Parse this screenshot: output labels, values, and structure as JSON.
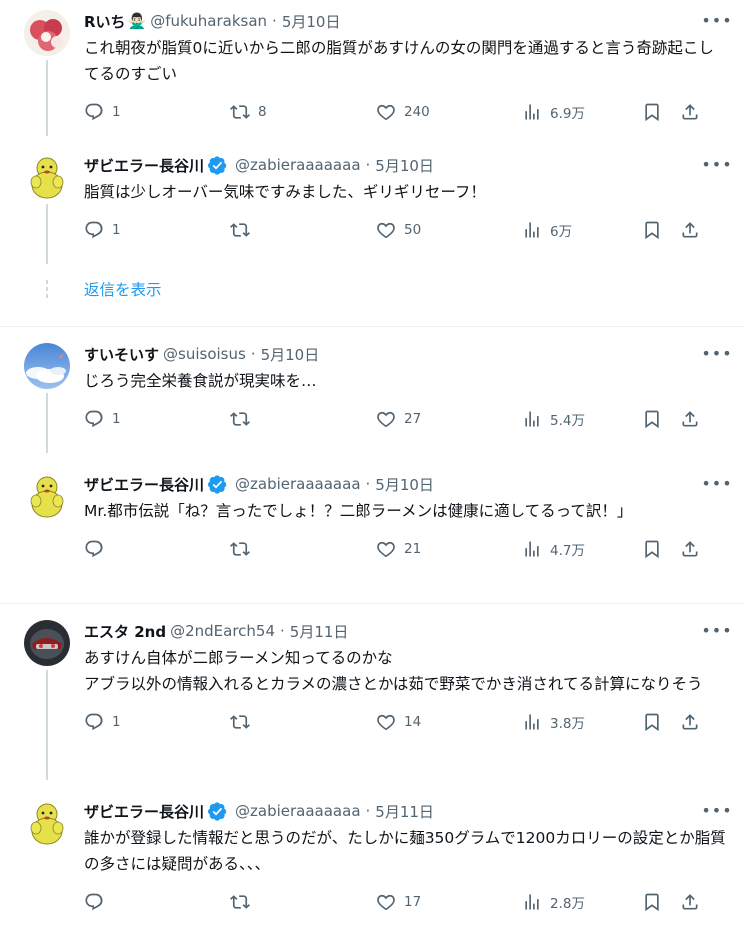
{
  "threads": [
    {
      "tweets": [
        {
          "name": "Rいち",
          "name_emoji": "🙅🏻‍♂️",
          "handle": "@fukuharaksan",
          "date": "5月10日",
          "verified": false,
          "avatar": "lychee",
          "text": "これ朝夜が脂質0に近いから二郎の脂質があすけんの女の関門を通過すると言う奇跡起こしてるのすごい",
          "replies": "1",
          "retweets": "8",
          "likes": "240",
          "views": "6.9万"
        },
        {
          "name": "ザビエラー長谷川",
          "handle": "@zabieraaaaaaa",
          "date": "5月10日",
          "verified": true,
          "avatar": "mascot",
          "text": "脂質は少しオーバー気味ですみました、ギリギリセーフ！",
          "replies": "1",
          "retweets": "",
          "likes": "50",
          "views": "6万"
        }
      ],
      "show_replies": "返信を表示"
    },
    {
      "tweets": [
        {
          "name": "すいそいす",
          "handle": "@suisoisus",
          "date": "5月10日",
          "verified": false,
          "avatar": "sky",
          "text": "じろう完全栄養食説が現実味を…",
          "replies": "1",
          "retweets": "",
          "likes": "27",
          "views": "5.4万"
        },
        {
          "name": "ザビエラー長谷川",
          "handle": "@zabieraaaaaaa",
          "date": "5月10日",
          "verified": true,
          "avatar": "mascot",
          "text": "Mr.都市伝説「ね？言ったでしょ！？二郎ラーメンは健康に適してるって訳！」",
          "replies": "",
          "retweets": "",
          "likes": "21",
          "views": "4.7万"
        }
      ]
    },
    {
      "tweets": [
        {
          "name": "エスタ 2nd",
          "handle": "@2ndEarch54",
          "date": "5月11日",
          "verified": false,
          "avatar": "helmet",
          "text": "あすけん自体が二郎ラーメン知ってるのかな\nアブラ以外の情報入れるとカラメの濃さとかは茹で野菜でかき消されてる計算になりそう",
          "replies": "1",
          "retweets": "",
          "likes": "14",
          "views": "3.8万"
        },
        {
          "name": "ザビエラー長谷川",
          "handle": "@zabieraaaaaaa",
          "date": "5月11日",
          "verified": true,
          "avatar": "mascot",
          "text": "誰かが登録した情報だと思うのだが、たしかに麺350グラムで1200カロリーの設定とか脂質の多さには疑問がある、、、",
          "replies": "",
          "retweets": "",
          "likes": "17",
          "views": "2.8万"
        }
      ]
    }
  ],
  "colors": {
    "accent": "#1d9bf0",
    "muted": "#536471",
    "thread_line": "#cfd9de",
    "mascot": "#e6e04a"
  }
}
